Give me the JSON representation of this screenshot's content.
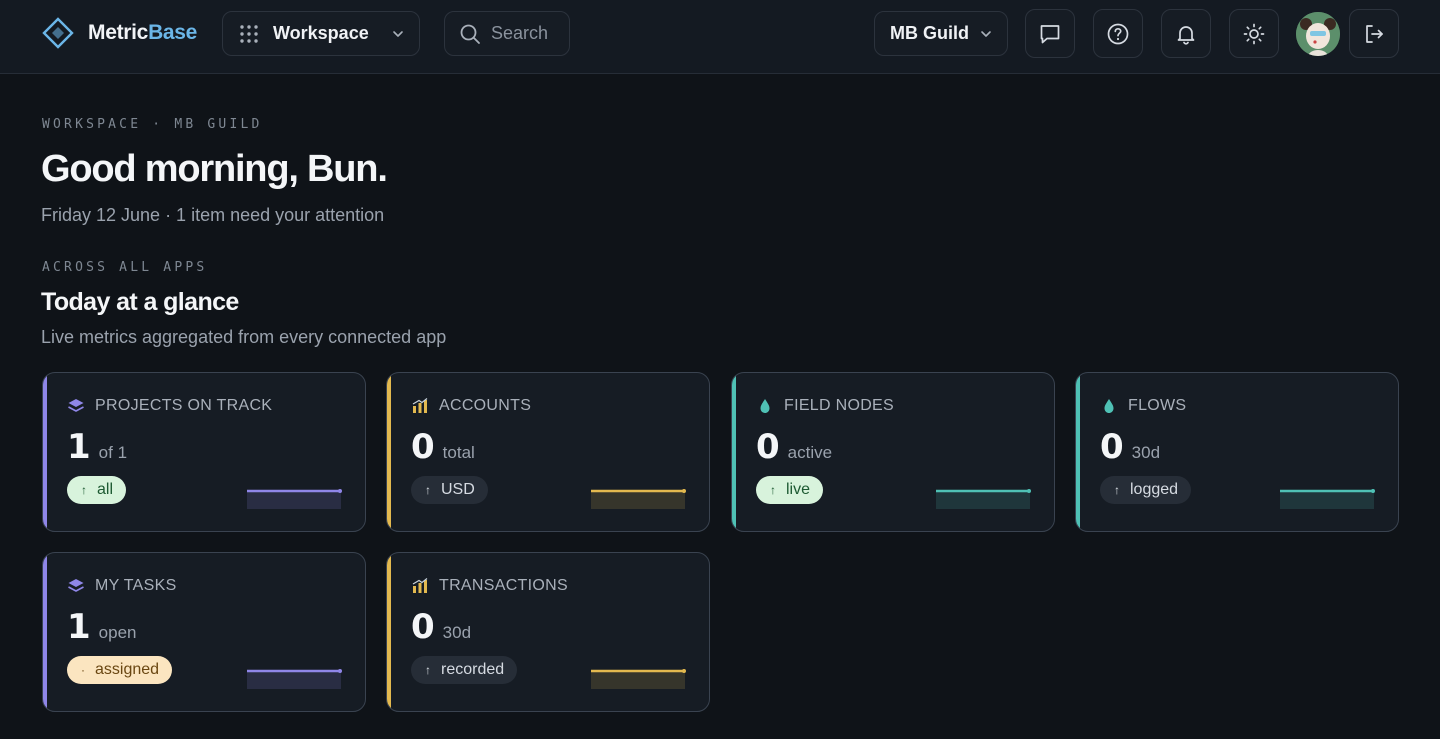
{
  "header": {
    "brand_a": "Metric",
    "brand_b": "Base",
    "workspace_label": "Workspace",
    "search_placeholder": "Search",
    "guild_label": "MB Guild",
    "icons": [
      "chat-icon",
      "help-icon",
      "bell-icon",
      "sun-icon",
      "logout-icon"
    ]
  },
  "intro": {
    "eyebrow": "WORKSPACE · MB GUILD",
    "greeting": "Good morning, Bun.",
    "subtitle": "Friday 12 June · 1 item need your attention"
  },
  "glance": {
    "eyebrow": "ACROSS ALL APPS",
    "title": "Today at a glance",
    "subtitle": "Live metrics aggregated from every connected app"
  },
  "cards": [
    {
      "title": "PROJECTS ON TRACK",
      "value": "1",
      "unit": "of 1",
      "tag": "all",
      "tag_arrow": "↑",
      "icon": "layers-icon",
      "color": "#8f86e8",
      "tag_style": "green"
    },
    {
      "title": "ACCOUNTS",
      "value": "0",
      "unit": "total",
      "tag": "USD",
      "tag_arrow": "↑",
      "icon": "bar-chart-icon",
      "color": "#e3b94f",
      "tag_style": "dark"
    },
    {
      "title": "FIELD NODES",
      "value": "0",
      "unit": "active",
      "tag": "live",
      "tag_arrow": "↑",
      "icon": "droplet-icon",
      "color": "#4fc1b5",
      "tag_style": "green"
    },
    {
      "title": "FLOWS",
      "value": "0",
      "unit": "30d",
      "tag": "logged",
      "tag_arrow": "↑",
      "icon": "droplet-icon",
      "color": "#4fc1b5",
      "tag_style": "dark"
    },
    {
      "title": "MY TASKS",
      "value": "1",
      "unit": "open",
      "tag": "assigned",
      "tag_arrow": "·",
      "icon": "layers-icon",
      "color": "#8f86e8",
      "tag_style": "cream"
    },
    {
      "title": "TRANSACTIONS",
      "value": "0",
      "unit": "30d",
      "tag": "recorded",
      "tag_arrow": "↑",
      "icon": "bar-chart-icon",
      "color": "#e3b94f",
      "tag_style": "dark"
    }
  ]
}
